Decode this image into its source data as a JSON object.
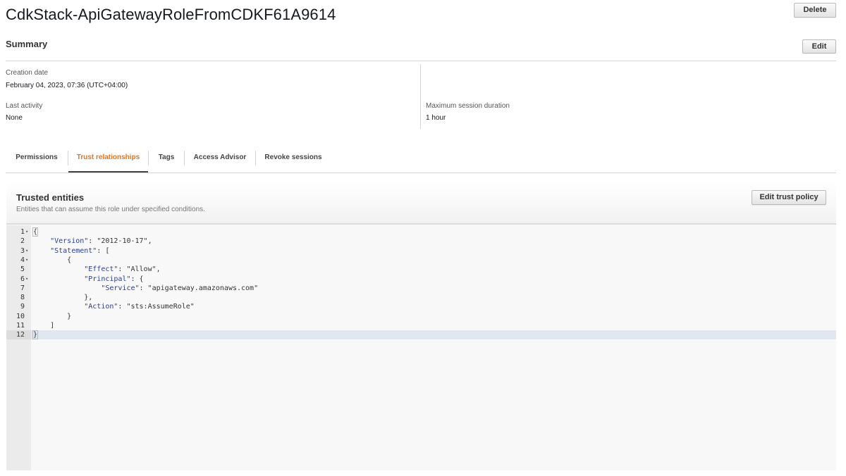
{
  "header": {
    "title": "CdkStack-ApiGatewayRoleFromCDKF61A9614",
    "delete_label": "Delete"
  },
  "summary": {
    "title": "Summary",
    "edit_label": "Edit",
    "fields": {
      "creation_date": {
        "label": "Creation date",
        "value": "February 04, 2023, 07:36 (UTC+04:00)"
      },
      "last_activity": {
        "label": "Last activity",
        "value": "None"
      },
      "max_session": {
        "label": "Maximum session duration",
        "value": "1 hour"
      }
    }
  },
  "tabs": [
    {
      "label": "Permissions",
      "active": false
    },
    {
      "label": "Trust relationships",
      "active": true
    },
    {
      "label": "Tags",
      "active": false
    },
    {
      "label": "Access Advisor",
      "active": false
    },
    {
      "label": "Revoke sessions",
      "active": false
    }
  ],
  "trusted_entities": {
    "title": "Trusted entities",
    "subtitle": "Entities that can assume this role under specified conditions.",
    "edit_label": "Edit trust policy"
  },
  "policy": {
    "lines": [
      {
        "n": "1",
        "fold": true,
        "text": "{"
      },
      {
        "n": "2",
        "fold": false,
        "text": "    \"Version\": \"2012-10-17\","
      },
      {
        "n": "3",
        "fold": true,
        "text": "    \"Statement\": ["
      },
      {
        "n": "4",
        "fold": true,
        "text": "        {"
      },
      {
        "n": "5",
        "fold": false,
        "text": "            \"Effect\": \"Allow\","
      },
      {
        "n": "6",
        "fold": true,
        "text": "            \"Principal\": {"
      },
      {
        "n": "7",
        "fold": false,
        "text": "                \"Service\": \"apigateway.amazonaws.com\""
      },
      {
        "n": "8",
        "fold": false,
        "text": "            },"
      },
      {
        "n": "9",
        "fold": false,
        "text": "            \"Action\": \"sts:AssumeRole\""
      },
      {
        "n": "10",
        "fold": false,
        "text": "        }"
      },
      {
        "n": "11",
        "fold": false,
        "text": "    ]"
      },
      {
        "n": "12",
        "fold": false,
        "text": "}"
      }
    ],
    "active_line": 12
  },
  "colors": {
    "accent_tab": "#ec7211",
    "json_key": "#2d3e8c",
    "active_line_bg": "#e1e7f1"
  }
}
